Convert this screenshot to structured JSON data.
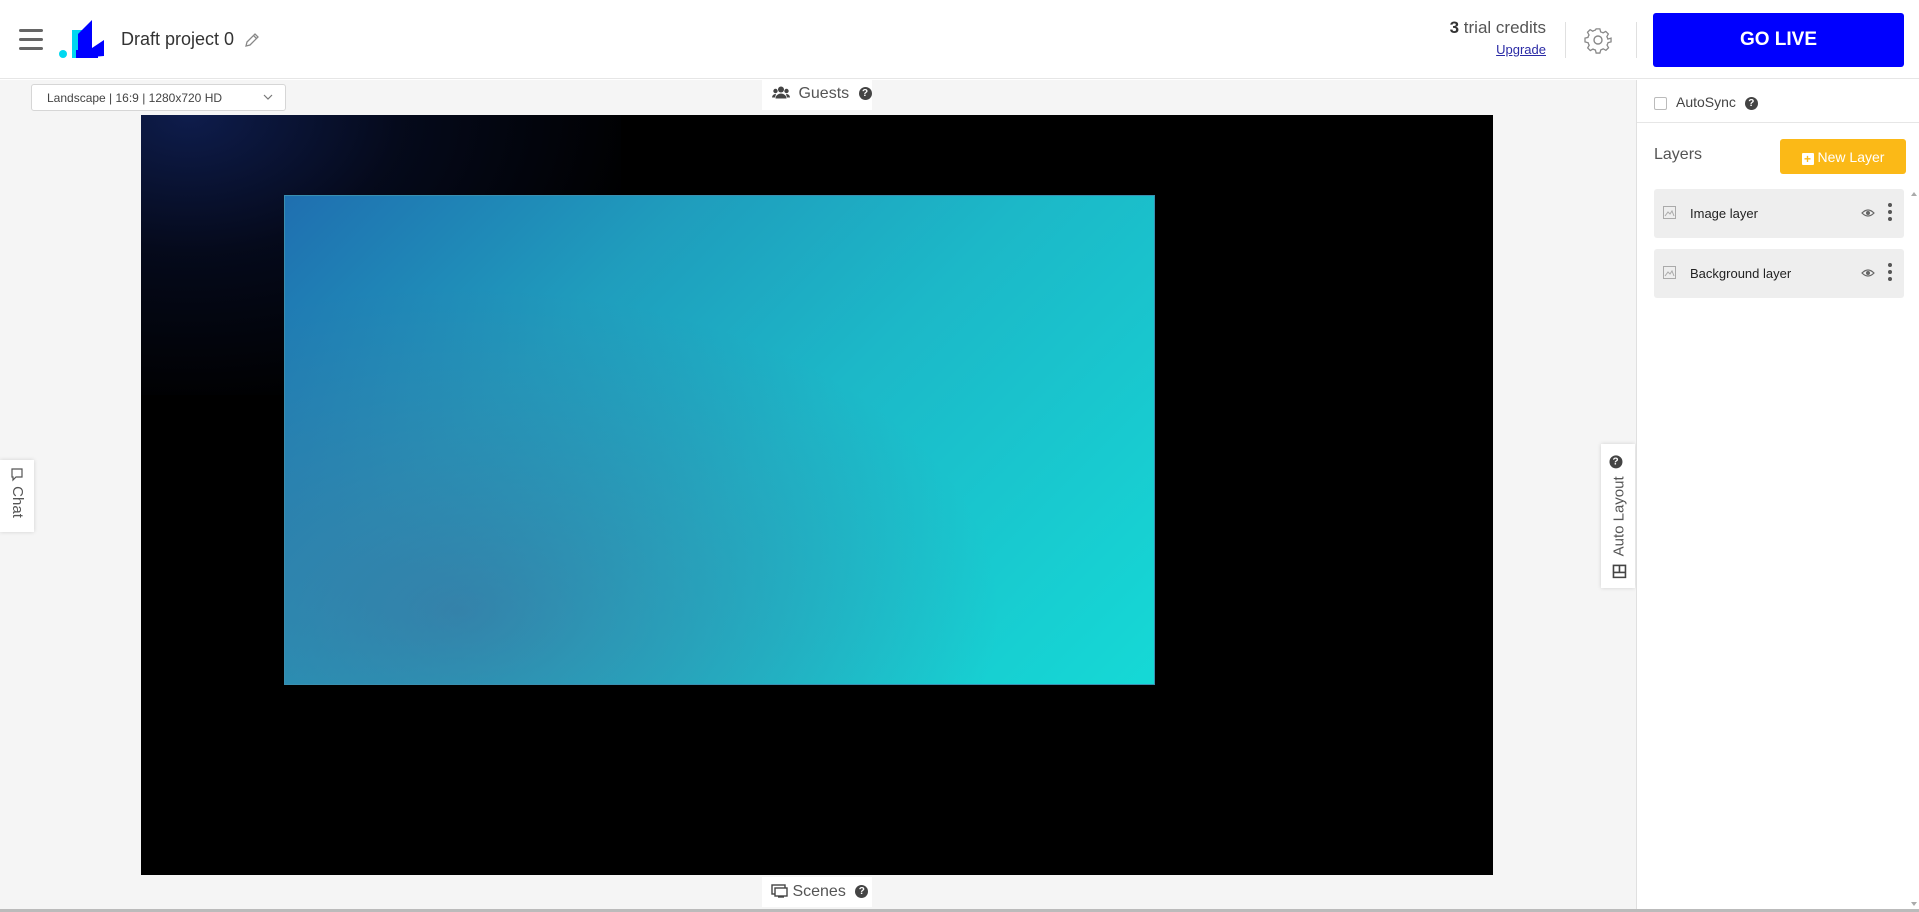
{
  "header": {
    "project_title": "Draft project 0",
    "credits_count": "3",
    "credits_label": " trial credits",
    "upgrade_label": "Upgrade",
    "go_live_label": "GO LIVE",
    "go_live_color": "#0000ff"
  },
  "stage": {
    "aspect_select_value": "Landscape | 16:9 | 1280x720 HD",
    "guests_label": "Guests",
    "scenes_label": "Scenes",
    "chat_label": "Chat",
    "auto_layout_label": "Auto Layout"
  },
  "panel": {
    "autosync_label": "AutoSync",
    "autosync_checked": false,
    "layers_title": "Layers",
    "new_layer_label": "New Layer",
    "new_layer_color": "#fbb917",
    "layers": [
      {
        "name": "Image layer",
        "icon": "image-icon",
        "visible": true
      },
      {
        "name": "Background layer",
        "icon": "image-icon",
        "visible": true
      }
    ]
  },
  "icons": {
    "menu": "hamburger-icon",
    "settings": "gear-icon",
    "edit": "pencil-icon",
    "guests": "users-icon",
    "scenes": "scenes-icon",
    "help": "question-circle-icon",
    "chat": "chat-bubble-icon",
    "auto_layout": "layout-icon"
  },
  "logo_colors": {
    "primary": "#0000ff",
    "accent": "#00d8f0"
  }
}
